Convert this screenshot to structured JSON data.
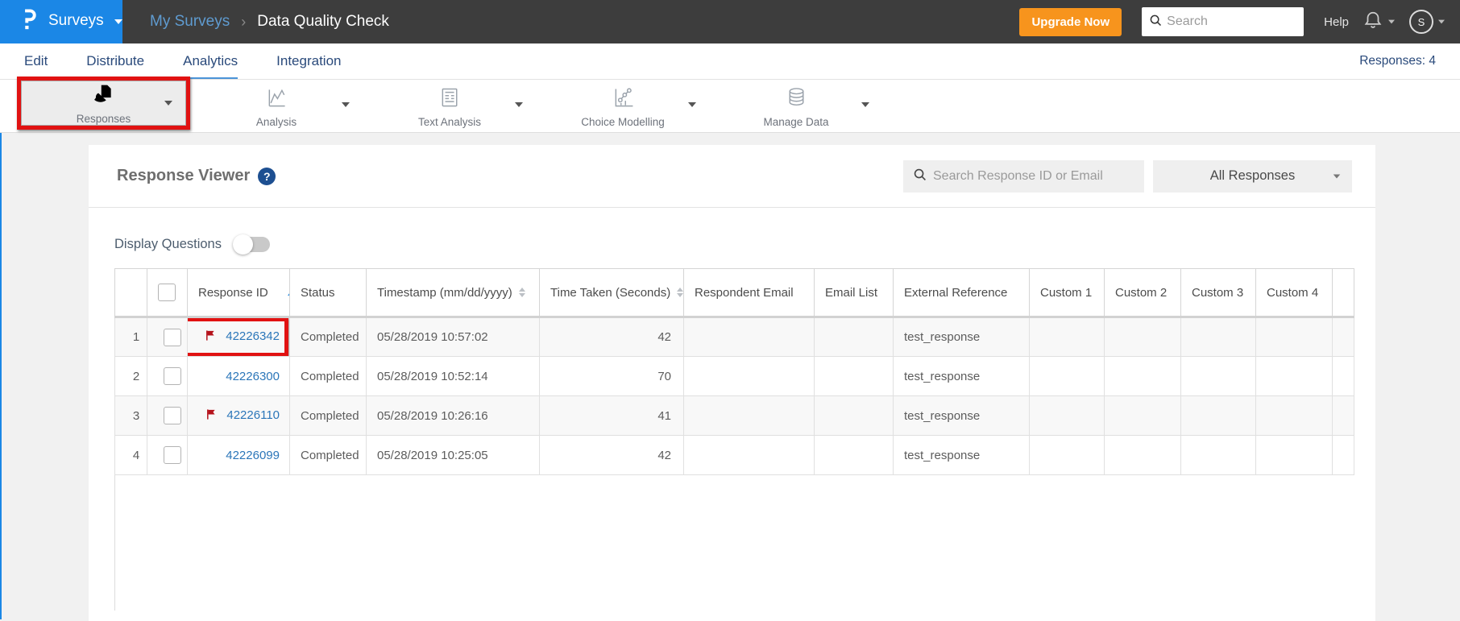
{
  "topbar": {
    "logo": "P",
    "product": "Surveys",
    "breadcrumb": {
      "parent": "My Surveys",
      "separator": "›",
      "current": "Data Quality Check"
    },
    "upgrade_label": "Upgrade Now",
    "search_placeholder": "Search",
    "help_label": "Help",
    "avatar_initial": "S"
  },
  "tabs": {
    "items": [
      {
        "label": "Edit"
      },
      {
        "label": "Distribute"
      },
      {
        "label": "Analytics"
      },
      {
        "label": "Integration"
      }
    ],
    "active": "Analytics",
    "responses_count": "Responses: 4"
  },
  "toolbar": {
    "items": [
      {
        "label": "Responses",
        "icon": "responses-icon",
        "selected": true,
        "annotated": true
      },
      {
        "label": "Analysis",
        "icon": "analysis-icon",
        "selected": false,
        "annotated": false
      },
      {
        "label": "Text Analysis",
        "icon": "text-analysis-icon",
        "selected": false,
        "annotated": false
      },
      {
        "label": "Choice Modelling",
        "icon": "choice-modelling-icon",
        "selected": false,
        "annotated": false
      },
      {
        "label": "Manage Data",
        "icon": "manage-data-icon",
        "selected": false,
        "annotated": false
      }
    ]
  },
  "viewer": {
    "title": "Response Viewer",
    "help_icon": "?",
    "search_placeholder": "Search Response ID or Email",
    "filter_value": "All Responses",
    "display_questions_label": "Display Questions",
    "display_questions_state": "off"
  },
  "table": {
    "columns": {
      "response_id": "Response ID",
      "status": "Status",
      "timestamp": "Timestamp (mm/dd/yyyy)",
      "time_taken": "Time Taken (Seconds)",
      "respondent_email": "Respondent Email",
      "email_list": "Email List",
      "external_reference": "External Reference",
      "custom_1": "Custom 1",
      "custom_2": "Custom 2",
      "custom_3": "Custom 3",
      "custom_4": "Custom 4"
    },
    "sort": {
      "column": "Response ID",
      "direction": "ascending"
    },
    "rows": [
      {
        "num": "1",
        "id": "42226342",
        "flagged": true,
        "annotated": true,
        "status": "Completed",
        "timestamp": "05/28/2019 10:57:02",
        "time_taken": "42",
        "respondent_email": "",
        "email_list": "",
        "external_reference": "test_response",
        "custom_1": "",
        "custom_2": "",
        "custom_3": "",
        "custom_4": ""
      },
      {
        "num": "2",
        "id": "42226300",
        "flagged": false,
        "annotated": false,
        "status": "Completed",
        "timestamp": "05/28/2019 10:52:14",
        "time_taken": "70",
        "respondent_email": "",
        "email_list": "",
        "external_reference": "test_response",
        "custom_1": "",
        "custom_2": "",
        "custom_3": "",
        "custom_4": ""
      },
      {
        "num": "3",
        "id": "42226110",
        "flagged": true,
        "annotated": false,
        "status": "Completed",
        "timestamp": "05/28/2019 10:26:16",
        "time_taken": "41",
        "respondent_email": "",
        "email_list": "",
        "external_reference": "test_response",
        "custom_1": "",
        "custom_2": "",
        "custom_3": "",
        "custom_4": ""
      },
      {
        "num": "4",
        "id": "42226099",
        "flagged": false,
        "annotated": false,
        "status": "Completed",
        "timestamp": "05/28/2019 10:25:05",
        "time_taken": "42",
        "respondent_email": "",
        "email_list": "",
        "external_reference": "test_response",
        "custom_1": "",
        "custom_2": "",
        "custom_3": "",
        "custom_4": ""
      }
    ]
  },
  "annotations": {
    "highlight_color": "#e11212",
    "highlighted_elements": [
      "toolbar Responses button",
      "row 1 Response ID cell"
    ]
  },
  "colors": {
    "brand_blue": "#1b87e6",
    "topbar_bg": "#3d3d3d",
    "upgrade_orange": "#f7941d",
    "link_blue": "#2b76b9",
    "flag_red": "#b5121b"
  }
}
